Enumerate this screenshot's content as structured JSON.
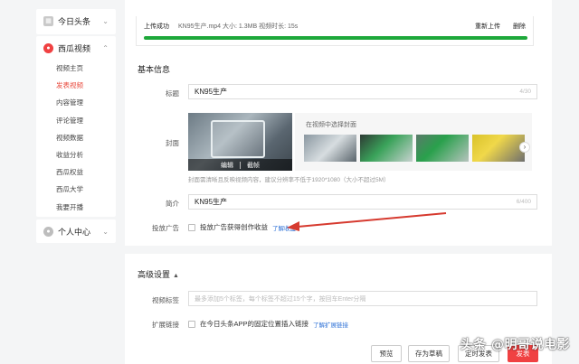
{
  "sidebar": {
    "toutiao": {
      "label": "今日头条"
    },
    "xigua": {
      "label": "西瓜视频",
      "items": [
        {
          "label": "视频主页"
        },
        {
          "label": "发表视频"
        },
        {
          "label": "内容管理"
        },
        {
          "label": "评论管理"
        },
        {
          "label": "视频数据"
        },
        {
          "label": "收益分析"
        },
        {
          "label": "西瓜权益"
        },
        {
          "label": "西瓜大学"
        },
        {
          "label": "我要开播"
        }
      ]
    },
    "personal": {
      "label": "个人中心"
    }
  },
  "upload": {
    "status": "上传成功",
    "meta": "KN95生产.mp4   大小: 1.3MB   视频时长: 15s",
    "reupload": "重新上传",
    "delete": "删除",
    "progress": 1.0
  },
  "basic": {
    "section_title": "基本信息",
    "title_label": "标题",
    "title_value": "KN95生产",
    "title_count": "4/30",
    "cover_label": "封面",
    "cover_edit": "编辑",
    "cover_capture": "截帧",
    "cover_pick_caption": "在视频中选择封面",
    "cover_hint": "封面需清晰且反映视频内容，建议分辨率不低于1920*1080（大小不超过5M）",
    "intro_label": "简介",
    "intro_value": "KN95生产",
    "intro_count": "6/400",
    "ads_label": "投放广告",
    "ads_option": "投放广告获得创作收益",
    "ads_more": "了解收益"
  },
  "advanced": {
    "title": "高级设置",
    "tags_label": "视频标签",
    "tags_placeholder": "最多添加5个标签，每个标签不超过15个字，按回车Enter分隔",
    "ext_label": "扩展链接",
    "ext_option": "在今日头条APP的固定位置插入链接",
    "ext_more": "了解扩展链接"
  },
  "footer": {
    "preview": "预览",
    "save_draft": "存为草稿",
    "schedule": "定时发表",
    "publish": "发表"
  },
  "watermark": "头条 @明哥说电影",
  "colors": {
    "accent": "#f04142",
    "progress": "#1ea83a",
    "link": "#2a6fd6",
    "arrow": "#d63a2f"
  }
}
